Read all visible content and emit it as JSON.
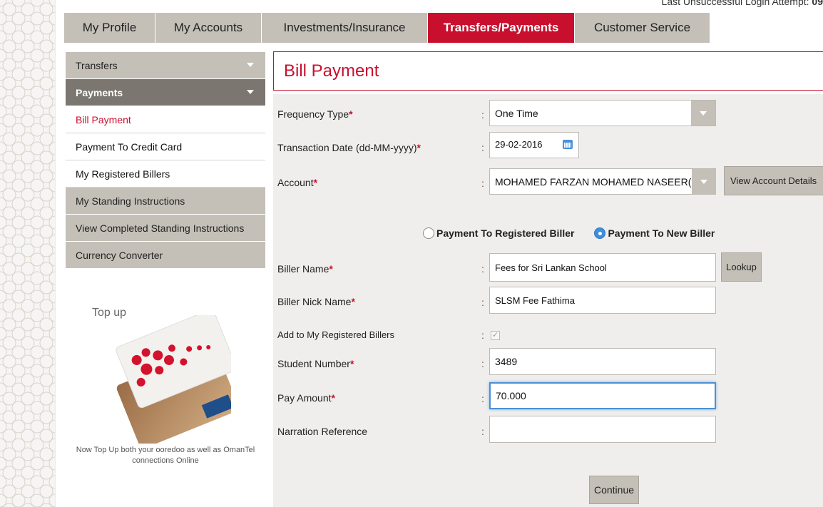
{
  "header": {
    "last_login_label": "Last Unsuccessful Login Attempt:",
    "last_login_value": "09"
  },
  "tabs": [
    {
      "label": "My Profile"
    },
    {
      "label": "My Accounts"
    },
    {
      "label": "Investments/Insurance"
    },
    {
      "label": "Transfers/Payments"
    },
    {
      "label": "Customer Service"
    }
  ],
  "sidebar": {
    "items": [
      {
        "label": "Transfers"
      },
      {
        "label": "Payments"
      },
      {
        "label": "Bill Payment"
      },
      {
        "label": "Payment To Credit Card"
      },
      {
        "label": "My Registered Billers"
      },
      {
        "label": "My Standing Instructions"
      },
      {
        "label": "View Completed Standing Instructions"
      },
      {
        "label": "Currency Converter"
      }
    ]
  },
  "promo": {
    "title": "Top up",
    "text": "Now Top Up both your ooredoo as well as OmanTel connections Online"
  },
  "page": {
    "title": "Bill Payment"
  },
  "form": {
    "frequency_label": "Frequency Type",
    "frequency_value": "One Time",
    "date_label": "Transaction Date (dd-MM-yyyy)",
    "date_value": "29-02-2016",
    "account_label": "Account",
    "account_value": "MOHAMED FARZAN MOHAMED NASEER(",
    "view_account_button": "View Account Details",
    "radio_registered": "Payment To Registered Biller",
    "radio_new": "Payment To New Biller",
    "biller_name_label": "Biller Name",
    "biller_name_value": "Fees for Sri Lankan  School",
    "lookup_button": "Lookup",
    "biller_nick_label": "Biller Nick Name",
    "biller_nick_value": "SLSM Fee Fathima",
    "add_registered_label": "Add to My Registered Billers",
    "add_registered_check": "✓",
    "student_number_label": "Student Number",
    "student_number_value": "3489",
    "pay_amount_label": "Pay Amount",
    "pay_amount_value": "70.000",
    "narration_label": "Narration Reference",
    "narration_value": "",
    "continue_button": "Continue",
    "colon": ":",
    "required_mark": "*"
  }
}
